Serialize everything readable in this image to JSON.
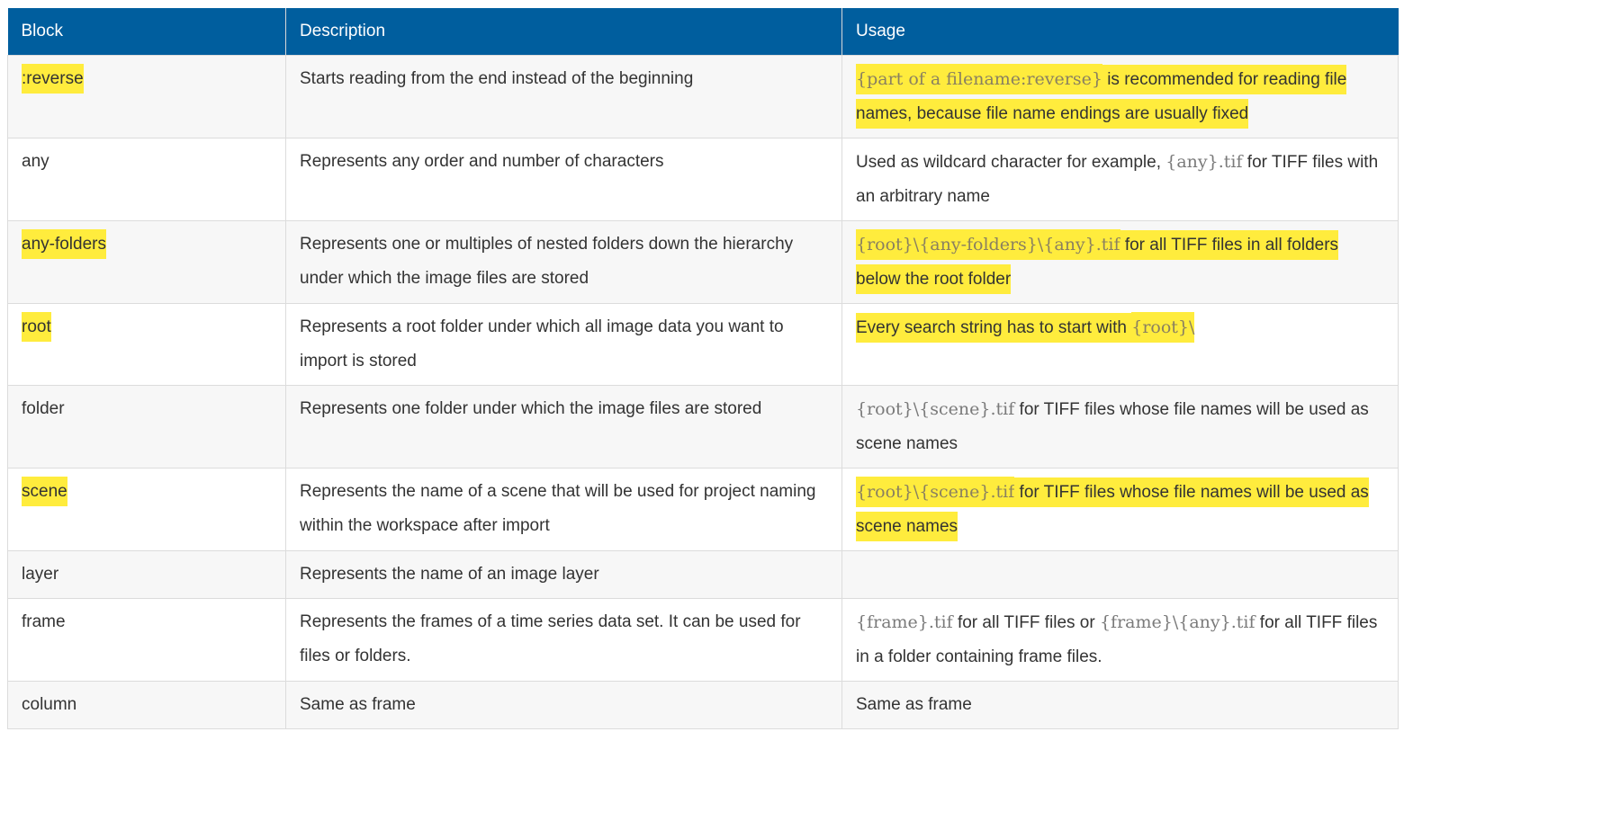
{
  "headers": [
    "Block",
    "Description",
    "Usage"
  ],
  "rows": [
    {
      "block": ":reverse",
      "block_highlight": true,
      "description": "Starts reading from the end instead of the beginning",
      "usage": [
        {
          "text": "{part of a file",
          "code": true,
          "hl": true
        },
        {
          "text": "name:reverse}",
          "code": true,
          "hl": true
        },
        {
          "text": " is recommended for reading file names, because file name endings are usually fixed",
          "code": false,
          "hl": true
        }
      ]
    },
    {
      "block": "any",
      "block_highlight": false,
      "description": "Represents any order and number of characters",
      "usage": [
        {
          "text": "Used as wildcard character for example, ",
          "code": false,
          "hl": false
        },
        {
          "text": "{any}.tif",
          "code": true,
          "hl": false
        },
        {
          "text": " for TIFF files with an arbitrary name",
          "code": false,
          "hl": false
        }
      ]
    },
    {
      "block": "any-folders",
      "block_highlight": true,
      "description": "Represents one or multiples of nested folders down the hierarchy under which the image files are stored",
      "usage": [
        {
          "text": "{root}\\",
          "code": true,
          "hl": true
        },
        {
          "text": "{any-folders}\\",
          "code": true,
          "hl": true
        },
        {
          "text": "{any}.tif",
          "code": true,
          "hl": true
        },
        {
          "text": " for all TIFF files in all folders below the root folder",
          "code": false,
          "hl": true
        }
      ]
    },
    {
      "block": "root",
      "block_highlight": true,
      "description": "Represents a root folder under which all image data you want to import is stored",
      "usage": [
        {
          "text": "Every search string has to start with ",
          "code": false,
          "hl": true
        },
        {
          "text": "{root}\\",
          "code": true,
          "hl": true
        }
      ]
    },
    {
      "block": "folder",
      "block_highlight": false,
      "description": "Represents one folder under which the image files are stored",
      "usage": [
        {
          "text": "{root}\\{scene}.tif",
          "code": true,
          "hl": false
        },
        {
          "text": " for TIFF files whose file names will be used as scene names",
          "code": false,
          "hl": false
        }
      ]
    },
    {
      "block": "scene",
      "block_highlight": true,
      "description": "Represents the name of a scene that will be used for project naming within the workspace after import",
      "usage": [
        {
          "text": "{root}\\{scene}.tif",
          "code": true,
          "hl": true
        },
        {
          "text": " for TIFF files whose file names will be used as scene names",
          "code": false,
          "hl": true
        }
      ]
    },
    {
      "block": "layer",
      "block_highlight": false,
      "description": "Represents the name of an image layer",
      "usage": []
    },
    {
      "block": "frame",
      "block_highlight": false,
      "description": "Represents the frames of a time series data set. It can be used for files or folders.",
      "usage": [
        {
          "text": "{frame}.tif",
          "code": true,
          "hl": false
        },
        {
          "text": " for all TIFF files or ",
          "code": false,
          "hl": false
        },
        {
          "text": "{frame}\\{any}.tif",
          "code": true,
          "hl": false
        },
        {
          "text": " for all TIFF files in a folder containing frame files.",
          "code": false,
          "hl": false
        }
      ]
    },
    {
      "block": "column",
      "block_highlight": false,
      "description": "Same as frame",
      "usage": [
        {
          "text": "Same as frame",
          "code": false,
          "hl": false
        }
      ]
    }
  ],
  "colors": {
    "header_bg": "#005e9e",
    "highlight": "#ffec3d",
    "row_alt": "#f7f7f7"
  }
}
